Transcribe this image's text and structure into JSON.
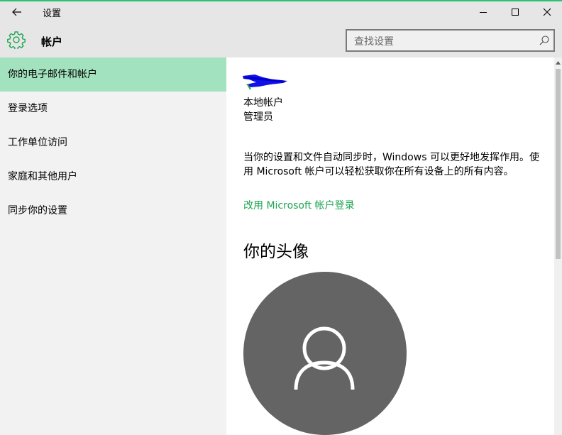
{
  "window": {
    "title": "设置"
  },
  "header": {
    "title": "帐户",
    "search_placeholder": "查找设置"
  },
  "sidebar": {
    "items": [
      {
        "label": "你的电子邮件和帐户",
        "active": true
      },
      {
        "label": "登录选项",
        "active": false
      },
      {
        "label": "工作单位访问",
        "active": false
      },
      {
        "label": "家庭和其他用户",
        "active": false
      },
      {
        "label": "同步你的设置",
        "active": false
      }
    ]
  },
  "main": {
    "account_type": "本地帐户",
    "account_role": "管理员",
    "description": "当你的设置和文件自动同步时，Windows 可以更好地发挥作用。使用 Microsoft 帐户可以轻松获取你在所有设备上的所有内容。",
    "ms_link": "改用 Microsoft 帐户登录",
    "avatar_section_title": "你的头像"
  },
  "colors": {
    "accent": "#1da552",
    "nav_active": "#a3e2be",
    "avatar_bg": "#646464"
  },
  "icons": [
    "back-arrow-icon",
    "minimize-icon",
    "maximize-icon",
    "close-icon",
    "gear-icon",
    "search-icon",
    "user-icon"
  ]
}
